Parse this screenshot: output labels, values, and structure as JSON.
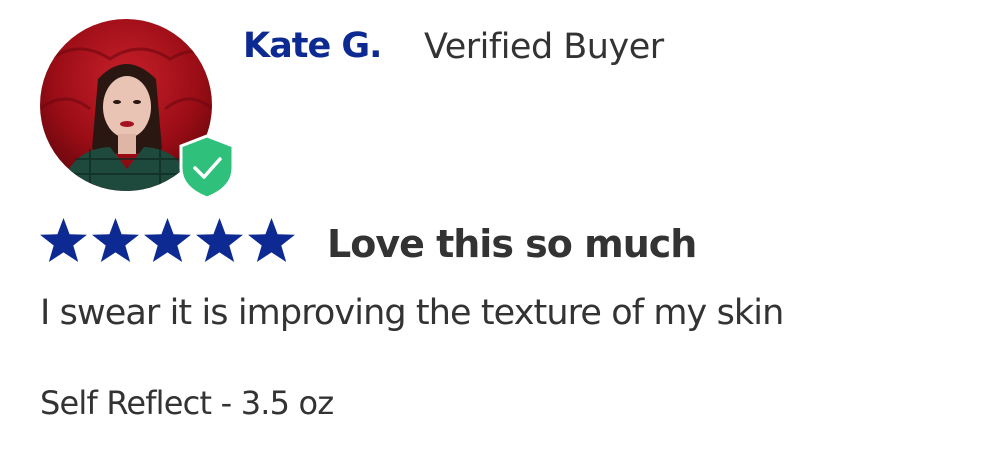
{
  "reviewer": {
    "name": "Kate G.",
    "status": "Verified Buyer",
    "avatar_icon": "avatar-photo",
    "badge_icon": "verified-shield-check-icon"
  },
  "rating": {
    "stars": 5,
    "max_stars": 5,
    "color": "#0d2a92"
  },
  "review": {
    "title": "Love this so much",
    "body": "I swear it is improving the texture of my skin",
    "variant": "Self Reflect - 3.5 oz"
  },
  "colors": {
    "brand": "#0d2a92",
    "badge": "#2fc07c",
    "text": "#333333"
  }
}
